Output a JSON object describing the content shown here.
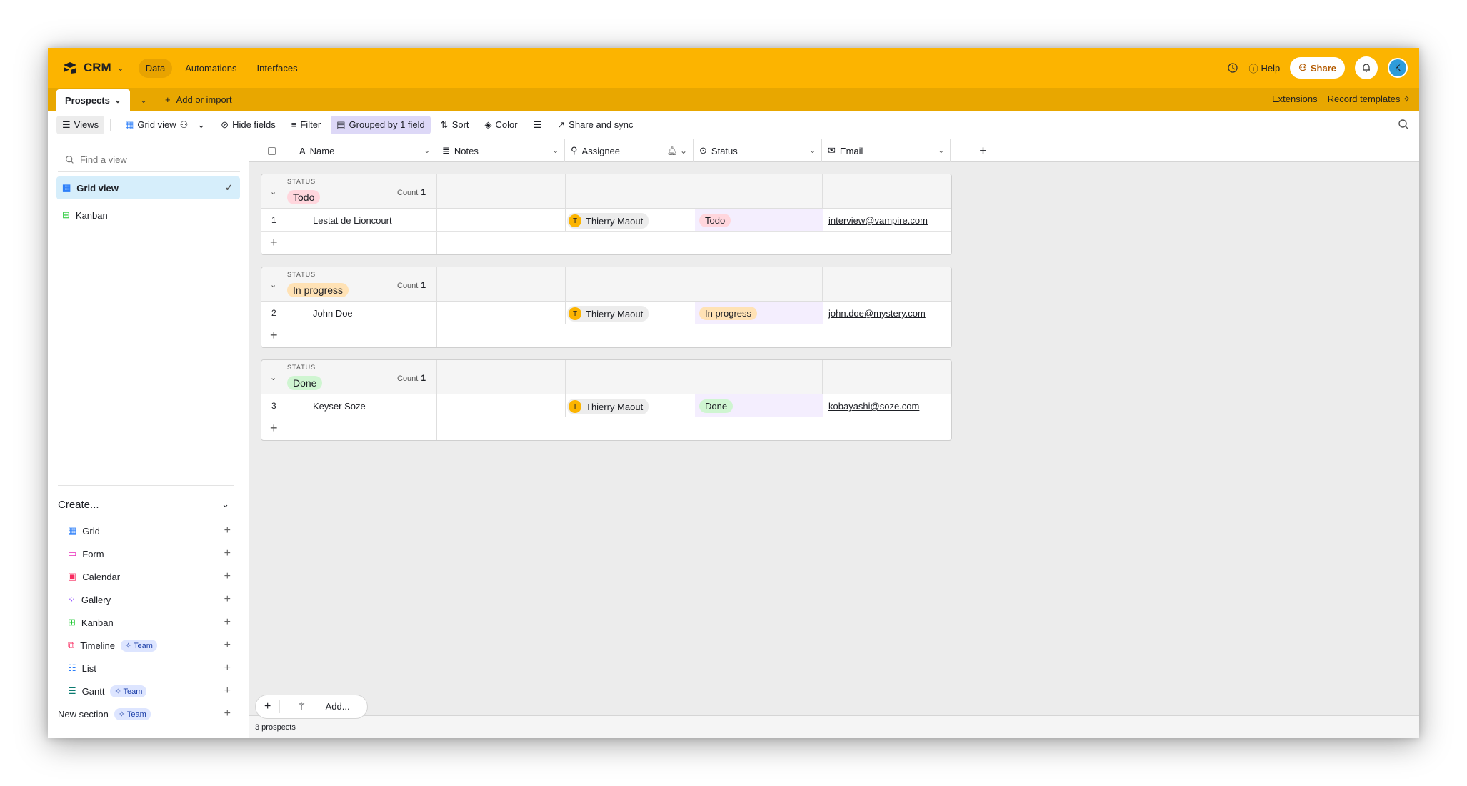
{
  "app": {
    "name": "CRM",
    "nav": [
      "Data",
      "Automations",
      "Interfaces"
    ],
    "help": "Help",
    "share": "Share",
    "avatar": "K"
  },
  "tabs": {
    "active": "Prospects",
    "add_or_import": "Add or import",
    "extensions": "Extensions",
    "record_templates": "Record templates"
  },
  "toolbar": {
    "views": "Views",
    "grid_view": "Grid view",
    "hide_fields": "Hide fields",
    "filter": "Filter",
    "grouped": "Grouped by 1 field",
    "sort": "Sort",
    "color": "Color",
    "share_sync": "Share and sync"
  },
  "sidebar": {
    "find_placeholder": "Find a view",
    "views": [
      {
        "label": "Grid view",
        "icon": "grid-icon"
      },
      {
        "label": "Kanban",
        "icon": "kanban-icon"
      }
    ],
    "create_label": "Create...",
    "create_items": [
      {
        "label": "Grid",
        "icon": "grid-icon",
        "color": "#2d7ff9"
      },
      {
        "label": "Form",
        "icon": "form-icon",
        "color": "#e929ba"
      },
      {
        "label": "Calendar",
        "icon": "calendar-icon",
        "color": "#f82b60"
      },
      {
        "label": "Gallery",
        "icon": "gallery-icon",
        "color": "#8b46ff"
      },
      {
        "label": "Kanban",
        "icon": "kanban-icon",
        "color": "#20c933"
      },
      {
        "label": "Timeline",
        "icon": "timeline-icon",
        "color": "#f82b60",
        "tag": "Team"
      },
      {
        "label": "List",
        "icon": "list-icon",
        "color": "#2d7ff9"
      },
      {
        "label": "Gantt",
        "icon": "gantt-icon",
        "color": "#0b7a70",
        "tag": "Team"
      },
      {
        "label": "New section",
        "icon": "",
        "color": "",
        "tag": "Team"
      }
    ]
  },
  "grid": {
    "columns": [
      "Name",
      "Notes",
      "Assignee",
      "Status",
      "Email"
    ],
    "group_label": "STATUS",
    "count_label": "Count",
    "groups": [
      {
        "status": "Todo",
        "count": "1",
        "pill_color": "#ffd6dd",
        "rows": [
          {
            "num": "1",
            "name": "Lestat de Lioncourt",
            "assignee": "Thierry Maout",
            "assignee_initial": "T",
            "status": "Todo",
            "email": "interview@vampire.com"
          }
        ]
      },
      {
        "status": "In progress",
        "count": "1",
        "pill_color": "#ffe2b5",
        "rows": [
          {
            "num": "2",
            "name": "John Doe",
            "assignee": "Thierry Maout",
            "assignee_initial": "T",
            "status": "In progress",
            "email": "john.doe@mystery.com"
          }
        ]
      },
      {
        "status": "Done",
        "count": "1",
        "pill_color": "#cff5d1",
        "rows": [
          {
            "num": "3",
            "name": "Keyser Soze",
            "assignee": "Thierry Maout",
            "assignee_initial": "T",
            "status": "Done",
            "email": "kobayashi@soze.com"
          }
        ]
      }
    ],
    "add_label": "Add...",
    "record_count": "3 prospects"
  }
}
